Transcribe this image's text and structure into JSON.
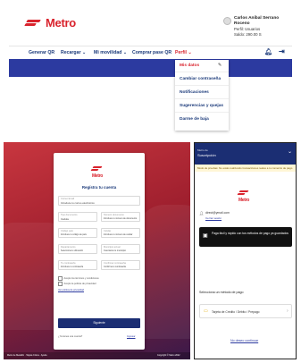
{
  "brand": {
    "name": "Metro",
    "color": "#d9232d"
  },
  "user": {
    "name": "Carlos Aníbal Serrano Roceno",
    "line1": "Perfil: Usuarios",
    "line2": "Saldo: 290.00 S"
  },
  "nav": {
    "items": [
      "Generar QR",
      "Recargar",
      "Mi movilidad",
      "Comprar pase QR",
      "Perfil"
    ],
    "active": "Perfil"
  },
  "profile_menu": {
    "items": [
      "Mis datos",
      "Cambiar contraseña",
      "Notificaciones",
      "Sugerencias y quejas",
      "Darme de baja"
    ]
  },
  "register": {
    "title": "Regístra tu cuenta",
    "fields": [
      {
        "label": "Correo Email",
        "value": "Introduce tu correo electrónico"
      },
      {
        "label": "Tipo documento",
        "value": "Cédula"
      },
      {
        "label": "Número documento",
        "value": "Introduce tu número de documento"
      },
      {
        "label": "Código país",
        "value": "Introduce tu código de país"
      },
      {
        "label": "Celular",
        "value": "Introduce tu número de celular"
      },
      {
        "label": "Departamento",
        "value": "Selecciona tu ubicación"
      },
      {
        "label": "Municipio actual",
        "value": "Cuéntanos tu municipio"
      },
      {
        "label": "Tu contraseña",
        "value": "Introduce tu contraseña"
      },
      {
        "label": "Confirmar contraseña",
        "value": "Confirma tu contraseña"
      }
    ],
    "checks": [
      "Acepto los términos y condiciones",
      "Acepto la política de privacidad"
    ],
    "policy_link": "Ver política de privacidad",
    "submit": "Siguiente",
    "login_prompt": "¿Ya tienes una cuenta?",
    "login_link": "Ingresar",
    "footer_left": "Metro de Medellín · Tarjeta Cívica · Ayuda",
    "footer_right": "Copyright © Metro 2022"
  },
  "checkout": {
    "header_small": "Metro de",
    "header_title": "Suscripción",
    "notice": "Modo de pruebas: No estás realizando transacciones reales a tu comercio de pago",
    "email": "direct@ymail.com",
    "close_session": "Cerrar sesión",
    "promo_text": "Paga fácil y rápido con tus métodos de pago ya guardados",
    "methods_title": "Selecciona un método de pago",
    "method_label": "Tarjeta de Crédito / Débito / Prepago",
    "cancel": "No deseo continuar"
  }
}
